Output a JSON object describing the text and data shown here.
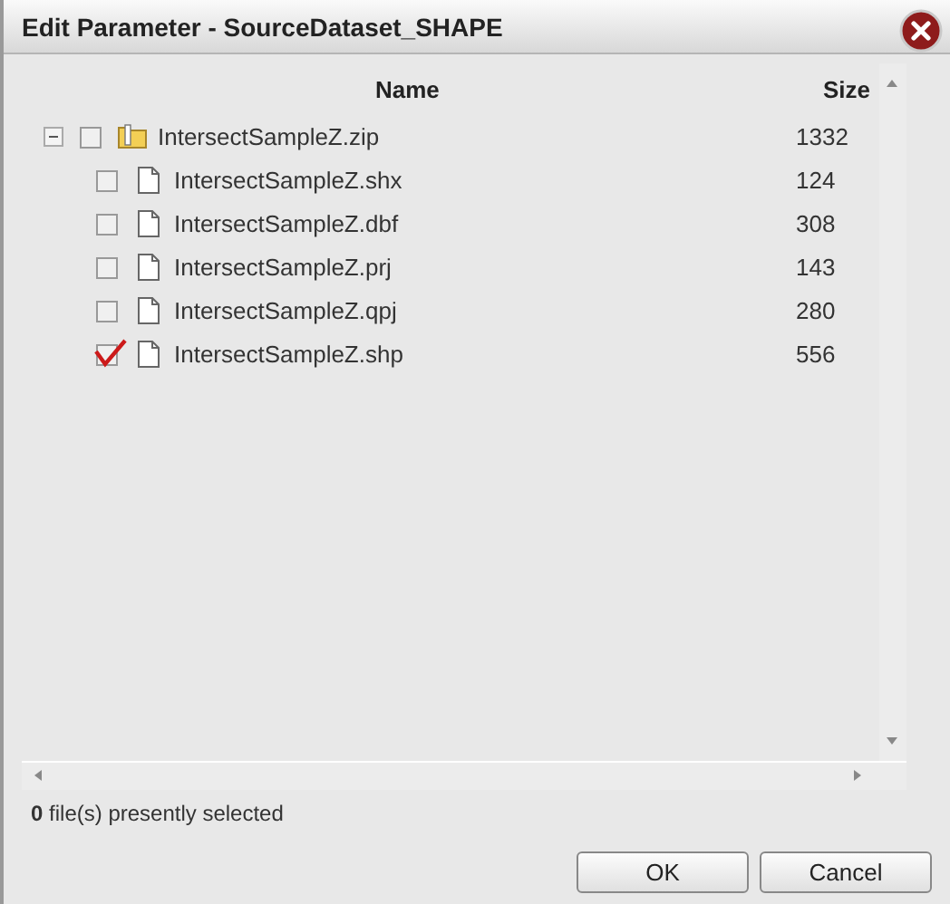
{
  "window": {
    "title": "Edit Parameter - SourceDataset_SHAPE"
  },
  "table": {
    "columns": [
      "Name",
      "Size"
    ],
    "rows": [
      {
        "name": "IntersectSampleZ.zip",
        "size": "1332",
        "kind": "folder",
        "expanded": true,
        "checked": false,
        "children": [
          {
            "name": "IntersectSampleZ.shx",
            "size": "124",
            "kind": "file",
            "checked": false
          },
          {
            "name": "IntersectSampleZ.dbf",
            "size": "308",
            "kind": "file",
            "checked": false
          },
          {
            "name": "IntersectSampleZ.prj",
            "size": "143",
            "kind": "file",
            "checked": false
          },
          {
            "name": "IntersectSampleZ.qpj",
            "size": "280",
            "kind": "file",
            "checked": false
          },
          {
            "name": "IntersectSampleZ.shp",
            "size": "556",
            "kind": "file",
            "checked": true
          }
        ]
      }
    ]
  },
  "status_bar": "**0** file(s) presently selected",
  "buttons": [
    "OK",
    "Cancel"
  ]
}
